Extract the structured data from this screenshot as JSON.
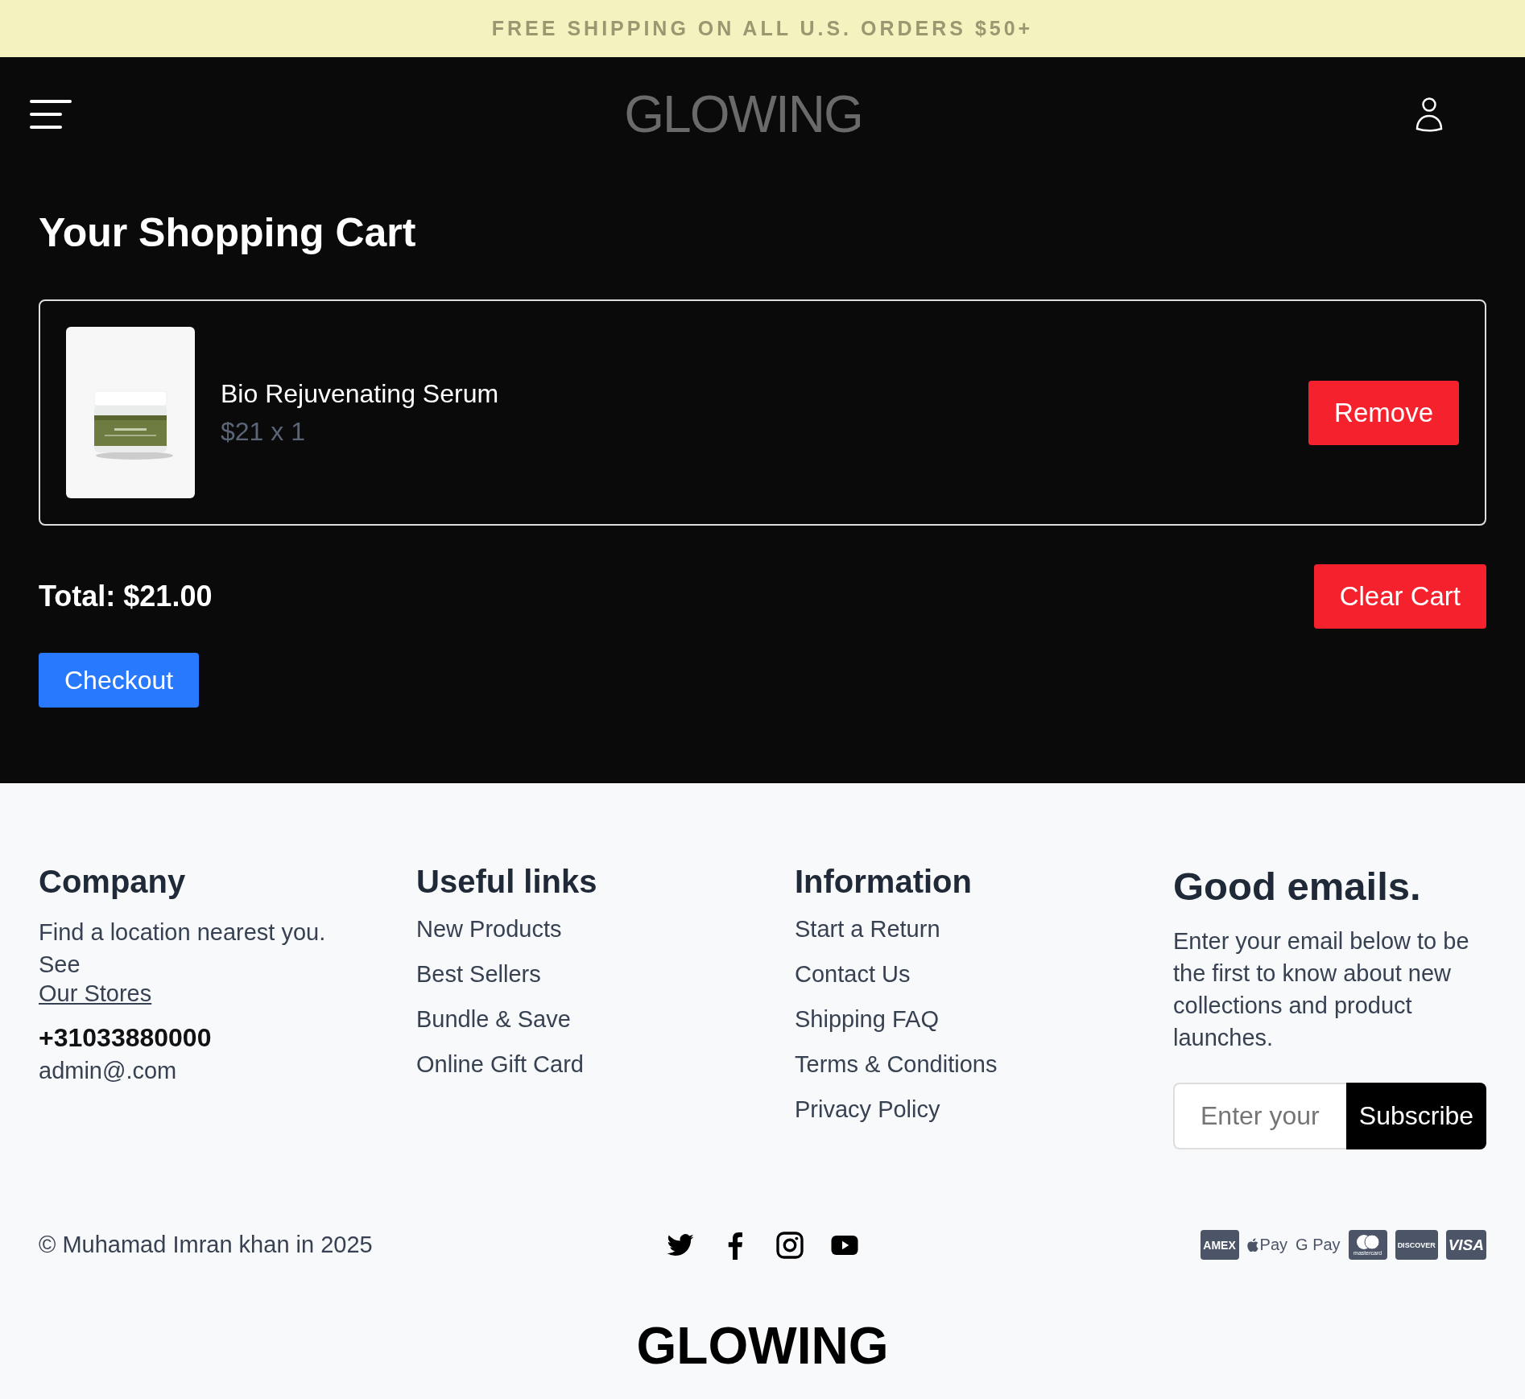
{
  "banner": {
    "text": "FREE SHIPPING ON ALL U.S. ORDERS $50+"
  },
  "header": {
    "logo": "GLOWING"
  },
  "cart": {
    "title": "Your Shopping Cart",
    "items": [
      {
        "name": "Bio Rejuvenating Serum",
        "price": "$21 x 1",
        "remove": "Remove"
      }
    ],
    "total": "Total: $21.00",
    "clear": "Clear Cart",
    "checkout": "Checkout"
  },
  "footer": {
    "columns": [
      {
        "kind": "company",
        "heading": "Company",
        "text": "Find a location nearest you. See",
        "link": "Our Stores",
        "phone": "+31033880000",
        "email": "admin@.com"
      },
      {
        "kind": "links",
        "heading": "Useful links",
        "links": [
          "New Products",
          "Best Sellers",
          "Bundle & Save",
          "Online Gift Card"
        ]
      },
      {
        "kind": "links",
        "heading": "Information",
        "links": [
          "Start a Return",
          "Contact Us",
          "Shipping FAQ",
          "Terms & Conditions",
          "Privacy Policy"
        ]
      },
      {
        "kind": "newsletter",
        "heading": "Good emails.",
        "text": "Enter your email below to be the first to know about new collections and product launches.",
        "placeholder": "Enter your",
        "button": "Subscribe"
      }
    ],
    "copyright": "© Muhamad Imran khan in 2025",
    "social": [
      {
        "kind": "twitter"
      },
      {
        "kind": "facebook"
      },
      {
        "kind": "instagram"
      },
      {
        "kind": "youtube"
      }
    ],
    "payments": [
      {
        "kind": "amex",
        "label": "AMEX"
      },
      {
        "kind": "apple",
        "label": "Pay"
      },
      {
        "kind": "google",
        "label": "G Pay"
      },
      {
        "kind": "mastercard",
        "label": "mastercard"
      },
      {
        "kind": "discover",
        "label": "DISCOVER"
      },
      {
        "kind": "visa",
        "label": "VISA"
      }
    ],
    "logo": "GLOWING"
  }
}
